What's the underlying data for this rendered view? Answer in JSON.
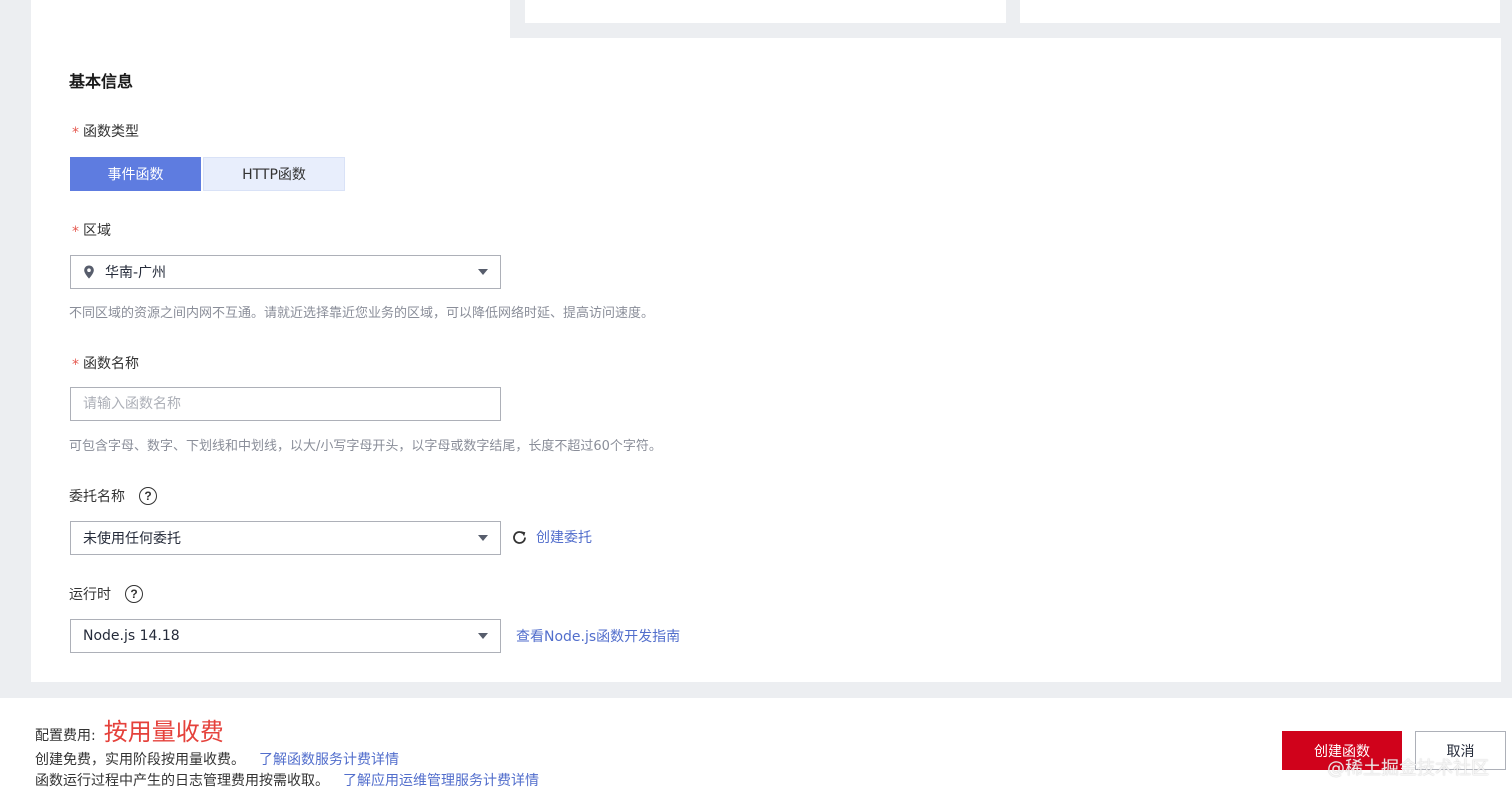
{
  "basic_info": {
    "title": "基本信息"
  },
  "function_type": {
    "label": "函数类型",
    "required_mark": "*",
    "options": [
      "事件函数",
      "HTTP函数"
    ],
    "selected": "事件函数"
  },
  "region": {
    "label": "区域",
    "required_mark": "*",
    "value": "华南-广州",
    "hint": "不同区域的资源之间内网不互通。请就近选择靠近您业务的区域，可以降低网络时延、提高访问速度。",
    "icon": "location-pin-icon"
  },
  "function_name": {
    "label": "函数名称",
    "required_mark": "*",
    "placeholder": "请输入函数名称",
    "value": "",
    "hint": "可包含字母、数字、下划线和中划线，以大/小写字母开头，以字母或数字结尾，长度不超过60个字符。"
  },
  "agency": {
    "label": "委托名称",
    "help_icon": "?",
    "value": "未使用任何委托",
    "create_link": "创建委托"
  },
  "runtime": {
    "label": "运行时",
    "help_icon": "?",
    "value": "Node.js 14.18",
    "guide_link": "查看Node.js函数开发指南"
  },
  "footer": {
    "fee_label": "配置费用:",
    "fee_value": "按用量收费",
    "note1": "创建免费，实用阶段按用量收费。",
    "note1_link": "了解函数服务计费详情",
    "note2": "函数运行过程中产生的日志管理费用按需收取。",
    "note2_link": "了解应用运维管理服务计费详情",
    "create_button": "创建函数",
    "cancel_button": "取消",
    "watermark": "@稀土掘金技术社区"
  },
  "colors": {
    "primary": "#5e7ce0",
    "danger": "#d0021b",
    "fee_red": "#e5413b",
    "link": "#526ecc"
  }
}
